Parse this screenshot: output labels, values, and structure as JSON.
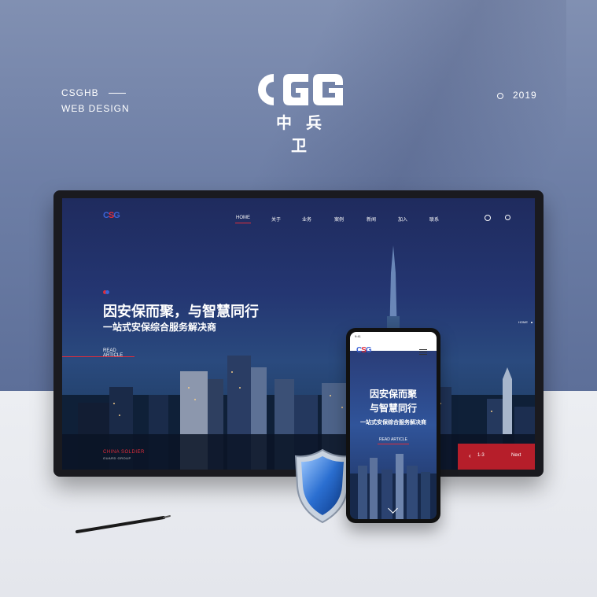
{
  "branding": {
    "name": "CSGHB",
    "label": "WEB DESIGN",
    "year": "2019",
    "logo_text": "CSG",
    "logo_cn": "中兵卫"
  },
  "desktop": {
    "nav": [
      "HOME",
      "关于",
      "业务",
      "案例",
      "新闻",
      "加入",
      "联系"
    ],
    "hero_title": "因安保而聚，与智慧同行",
    "hero_subtitle": "一站式安保综合服务解决商",
    "read_more": "READ ARTICLE",
    "breadcrumb": "HOME",
    "guard_text": "CHINA SOLDIER",
    "guard_sub": "GUARD GROUP",
    "pager_count": "1-3",
    "pager_next": "Next"
  },
  "mobile": {
    "time": "9:41",
    "title_line1": "因安保而聚",
    "title_line2": "与智慧同行",
    "subtitle": "一站式安保综合服务解决商",
    "read_more": "READ ARTICLE"
  },
  "colors": {
    "accent_red": "#e02d3a",
    "accent_blue": "#3c63d6",
    "bg_blue": "#6e7fa6"
  }
}
